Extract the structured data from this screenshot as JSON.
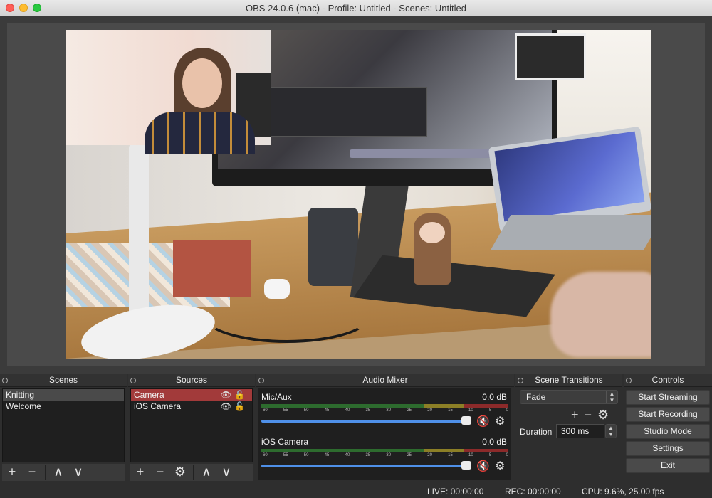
{
  "window": {
    "title": "OBS 24.0.6 (mac) - Profile: Untitled - Scenes: Untitled"
  },
  "scenes": {
    "header": "Scenes",
    "items": [
      {
        "label": "Knitting",
        "selected": true
      },
      {
        "label": "Welcome",
        "selected": false
      }
    ],
    "toolbar": {
      "add": "+",
      "remove": "−",
      "up": "∧",
      "down": "∨"
    }
  },
  "sources": {
    "header": "Sources",
    "items": [
      {
        "label": "Camera",
        "selected": true,
        "icons": "👁🔓"
      },
      {
        "label": "iOS Camera",
        "selected": false,
        "icons": "👁🔓"
      }
    ],
    "toolbar": {
      "add": "+",
      "remove": "−",
      "settings": "⚙",
      "up": "∧",
      "down": "∨"
    }
  },
  "mixer": {
    "header": "Audio Mixer",
    "ticks": [
      "-60",
      "-55",
      "-50",
      "-45",
      "-40",
      "-35",
      "-30",
      "-25",
      "-20",
      "-15",
      "-10",
      "-5",
      "0"
    ],
    "channels": [
      {
        "name": "Mic/Aux",
        "db": "0.0 dB",
        "muted": true
      },
      {
        "name": "iOS Camera",
        "db": "0.0 dB",
        "muted": true
      }
    ]
  },
  "transitions": {
    "header": "Scene Transitions",
    "selected": "Fade",
    "duration_label": "Duration",
    "duration_value": "300 ms"
  },
  "controls": {
    "header": "Controls",
    "buttons": [
      "Start Streaming",
      "Start Recording",
      "Studio Mode",
      "Settings",
      "Exit"
    ]
  },
  "status": {
    "live": "LIVE: 00:00:00",
    "rec": "REC: 00:00:00",
    "cpu": "CPU: 9.6%, 25.00 fps"
  },
  "colors": {
    "meter_green": "#2d6b2e",
    "meter_yellow": "#8c7f26",
    "meter_red": "#8c2a2a",
    "slider": "#4f90e8",
    "selected_source": "#a23a3a",
    "mute": "#e23d3d"
  }
}
